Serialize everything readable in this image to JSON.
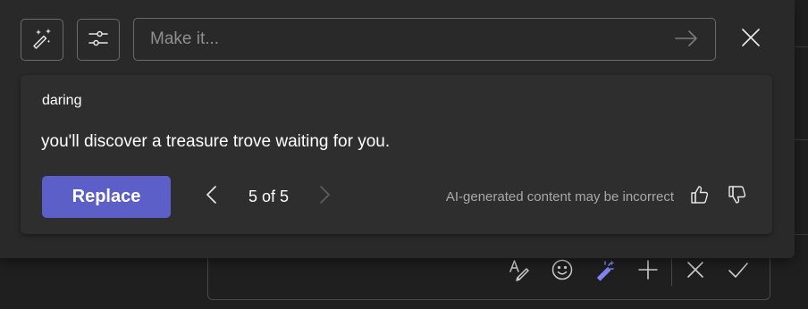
{
  "toolbar": {
    "rewrite_icon": "wand-sparkle-icon",
    "settings_icon": "sliders-icon"
  },
  "prompt": {
    "placeholder": "Make it...",
    "value": "",
    "send_icon": "arrow-right-icon",
    "close_icon": "close-icon"
  },
  "suggestion": {
    "tone": "daring",
    "text": "you'll discover a treasure trove waiting for you.",
    "replace_label": "Replace",
    "pager": "5 of 5",
    "current": 5,
    "total": 5,
    "disclaimer": "AI-generated content may be incorrect"
  },
  "compose": {
    "tools": [
      "format-icon",
      "emoji-icon",
      "copilot-wand-icon",
      "plus-icon",
      "discard-icon",
      "check-icon"
    ]
  },
  "colors": {
    "accent": "#5b5fc7",
    "popup_bg": "#292929",
    "card_bg": "#2e2e2e",
    "page_bg": "#1f1f1f",
    "muted_text": "#a8a8a8",
    "copilot_icon": "#7f85f5"
  }
}
